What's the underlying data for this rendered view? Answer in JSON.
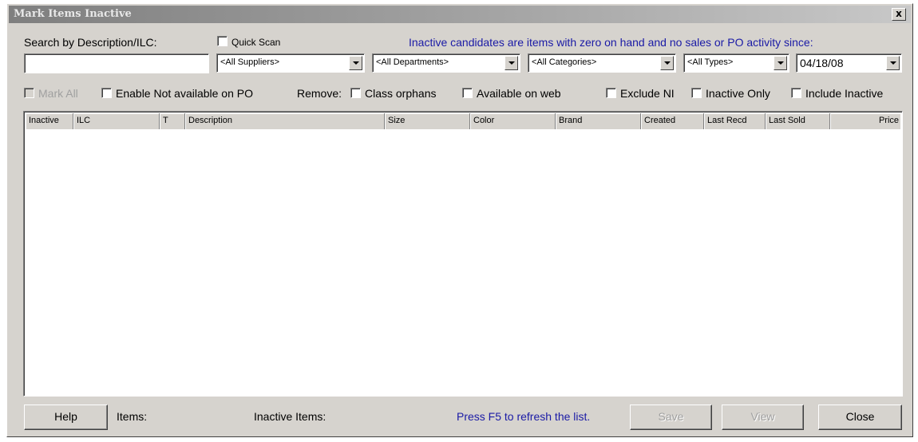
{
  "window": {
    "title": "Mark Items Inactive",
    "close_glyph": "x"
  },
  "search": {
    "label": "Search by Description/ILC:",
    "value": "",
    "placeholder": ""
  },
  "quick_scan": {
    "label": "Quick Scan",
    "checked": false
  },
  "info_text": "Inactive candidates are items with zero on hand and no sales or PO activity since:",
  "filters": {
    "suppliers": "<All Suppliers>",
    "departments": "<All Departments>",
    "categories": "<All Categories>",
    "types": "<All Types>",
    "since_date": "04/18/08"
  },
  "options": {
    "mark_all": "Mark All",
    "enable_not_available_on_po": "Enable Not available on PO",
    "remove_label": "Remove:",
    "class_orphans": "Class orphans",
    "available_on_web": "Available on web",
    "exclude_ni": "Exclude NI",
    "inactive_only": "Inactive Only",
    "include_inactive": "Include Inactive"
  },
  "table": {
    "columns": [
      "Inactive",
      "ILC",
      "T",
      "Description",
      "Size",
      "Color",
      "Brand",
      "Created",
      "Last Recd",
      "Last Sold",
      "Price"
    ],
    "rows": []
  },
  "footer": {
    "help": "Help",
    "items_label": "Items:",
    "inactive_items_label": "Inactive Items:",
    "refresh_hint": "Press F5 to refresh the list.",
    "save": "Save",
    "view": "View",
    "close": "Close"
  },
  "colors": {
    "dialog_bg": "#d6d3ce",
    "accent_text": "#1a1aa6"
  }
}
